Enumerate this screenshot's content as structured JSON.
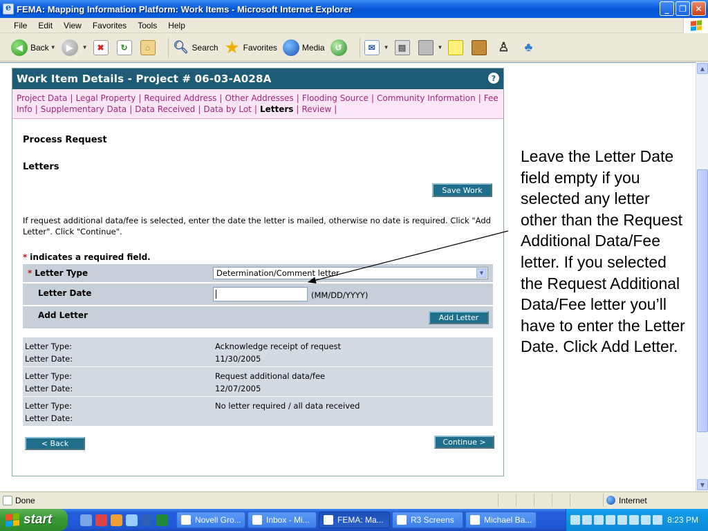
{
  "window": {
    "title": "FEMA: Mapping Information Platform: Work Items - Microsoft Internet Explorer"
  },
  "menu": [
    "File",
    "Edit",
    "View",
    "Favorites",
    "Tools",
    "Help"
  ],
  "toolbar": {
    "back": "Back",
    "search": "Search",
    "favorites": "Favorites",
    "media": "Media"
  },
  "page": {
    "header": "Work Item Details - Project # 06-03-A028A",
    "nav": [
      {
        "label": "Project Data",
        "active": false
      },
      {
        "label": "Legal Property",
        "active": false
      },
      {
        "label": "Required Address",
        "active": false
      },
      {
        "label": "Other Addresses",
        "active": false
      },
      {
        "label": "Flooding Source",
        "active": false
      },
      {
        "label": "Community Information",
        "active": false
      },
      {
        "label": "Fee Info",
        "active": false
      },
      {
        "label": "Supplementary Data",
        "active": false
      },
      {
        "label": "Data Received",
        "active": false
      },
      {
        "label": "Data by Lot",
        "active": false
      },
      {
        "label": "Letters",
        "active": true
      },
      {
        "label": "Review",
        "active": false
      }
    ],
    "process_request": "Process Request",
    "letters_title": "Letters",
    "save_work": "Save Work",
    "instruction": "If request additional data/fee is selected, enter the date the letter is mailed, otherwise no date is required. Click \"Add Letter\". Click \"Continue\".",
    "required_note": "indicates a required field.",
    "required_star": "*",
    "form": {
      "letter_type_label": "Letter Type",
      "letter_type_value": "Determination/Comment letter",
      "letter_date_label": "Letter Date",
      "letter_date_value": "",
      "letter_date_hint": "(MM/DD/YYYY)",
      "add_letter_label": "Add Letter",
      "add_letter_button": "Add Letter"
    },
    "letters": [
      {
        "type_label": "Letter Type:",
        "type": "Acknowledge receipt of request",
        "date_label": "Letter Date:",
        "date": "11/30/2005"
      },
      {
        "type_label": "Letter Type:",
        "type": "Request additional data/fee",
        "date_label": "Letter Date:",
        "date": "12/07/2005"
      },
      {
        "type_label": "Letter Type:",
        "type": "No letter required / all data received",
        "date_label": "Letter Date:",
        "date": ""
      }
    ],
    "back_button": "< Back",
    "continue_button": "Continue >"
  },
  "annotation": "Leave the Letter Date field empty if you selected any letter other than the Request Additional Data/Fee letter. If you selected the Request Additional Data/Fee letter you’ll have to enter the Letter Date. Click Add Letter.",
  "status": {
    "text": "Done",
    "zone": "Internet"
  },
  "taskbar": {
    "start": "start",
    "tasks": [
      {
        "label": "Novell Gro...",
        "active": false
      },
      {
        "label": "Inbox - Mi...",
        "active": false
      },
      {
        "label": "FEMA: Ma...",
        "active": true
      },
      {
        "label": "R3 Screens",
        "active": false
      },
      {
        "label": "Michael Ba...",
        "active": false
      }
    ],
    "clock": "8:23 PM"
  }
}
